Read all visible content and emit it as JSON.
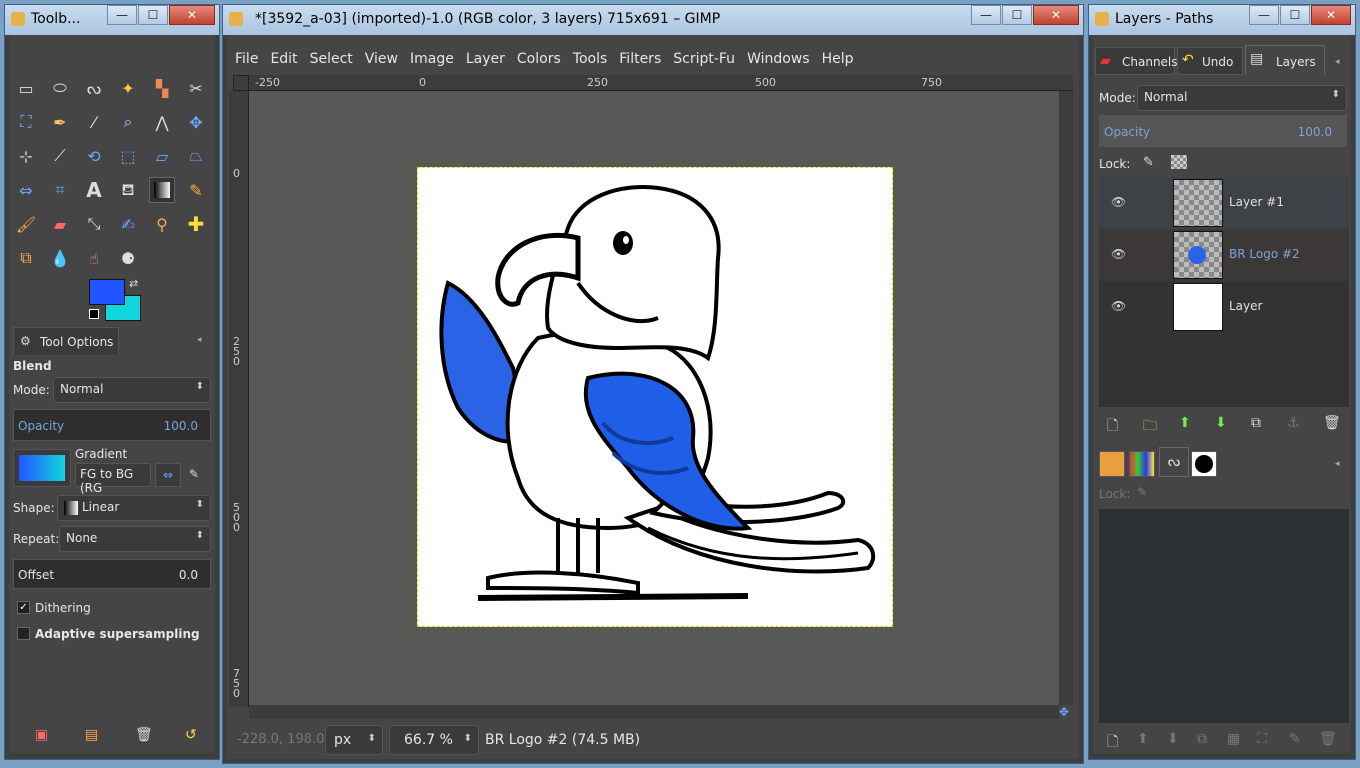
{
  "toolbox": {
    "title": "Toolb...",
    "tool_options_tab": "Tool Options",
    "tool_name": "Blend",
    "mode_label": "Mode:",
    "mode_value": "Normal",
    "opacity_label": "Opacity",
    "opacity_value": "100.0",
    "gradient_label": "Gradient",
    "gradient_value": "FG to BG (RG",
    "shape_label": "Shape:",
    "shape_value": "Linear",
    "repeat_label": "Repeat:",
    "repeat_value": "None",
    "offset_label": "Offset",
    "offset_value": "0.0",
    "dithering_label": "Dithering",
    "adaptive_label": "Adaptive supersampling",
    "fg_color": "#2255ff",
    "bg_color": "#11d6de"
  },
  "main_window": {
    "title": "*[3592_a-03] (imported)-1.0 (RGB color, 3 layers) 715x691 – GIMP",
    "menu": [
      "File",
      "Edit",
      "Select",
      "View",
      "Image",
      "Layer",
      "Colors",
      "Tools",
      "Filters",
      "Script-Fu",
      "Windows",
      "Help"
    ],
    "ruler_h": [
      "-250",
      "0",
      "250",
      "500",
      "750"
    ],
    "ruler_v": [
      "0",
      "250",
      "500",
      "750"
    ],
    "coords": "-228.0, 198.0",
    "unit": "px",
    "zoom": "66.7 %",
    "status": "BR Logo #2 (74.5 MB)"
  },
  "layers_panel": {
    "title": "Layers - Paths",
    "tabs": [
      "Channels",
      "Undo",
      "Layers"
    ],
    "mode_label": "Mode:",
    "mode_value": "Normal",
    "opacity_label": "Opacity",
    "opacity_value": "100.0",
    "lock_label": "Lock:",
    "lock2_label": "Lock:",
    "layers": [
      {
        "name": "Layer #1"
      },
      {
        "name": "BR Logo #2"
      },
      {
        "name": "Layer"
      }
    ]
  }
}
